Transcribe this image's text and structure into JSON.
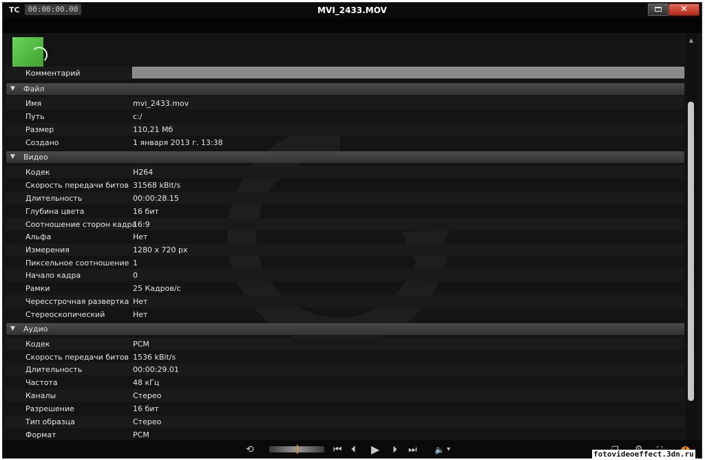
{
  "titlebar": {
    "tc_label": "TC",
    "timecode": "00:00:00.00",
    "title": "MVI_2433.MOV",
    "maximize_icon": "maximize-icon",
    "close_icon": "close-icon",
    "close_symbol": "✕"
  },
  "comment": {
    "label": "Комментарий",
    "value": ""
  },
  "sections": {
    "file": {
      "title": "Файл",
      "rows": [
        {
          "label": "Имя",
          "value": "mvi_2433.mov"
        },
        {
          "label": "Путь",
          "value": "c:/"
        },
        {
          "label": "Размер",
          "value": "110,21 Мб"
        },
        {
          "label": "Создано",
          "value": "1 января 2013 г. 13:38"
        }
      ]
    },
    "video": {
      "title": "Видео",
      "rows": [
        {
          "label": "Кодек",
          "value": "H264"
        },
        {
          "label": "Скорость передачи битов",
          "value": "31568 kBit/s"
        },
        {
          "label": "Длительность",
          "value": "00:00:28.15"
        },
        {
          "label": "Глубина цвета",
          "value": "16 бит"
        },
        {
          "label": "Соотношение сторон кадра",
          "value": "16:9"
        },
        {
          "label": "Альфа",
          "value": "Нет"
        },
        {
          "label": "Измерения",
          "value": "1280 x 720 px"
        },
        {
          "label": "Пиксельное соотношение",
          "value": "1"
        },
        {
          "label": "Начало кадра",
          "value": "0"
        },
        {
          "label": "Рамки",
          "value": "25 Кадров/с"
        },
        {
          "label": "Чересстрочная развертка",
          "value": "Нет"
        },
        {
          "label": "Стереоскопический",
          "value": "Нет"
        }
      ]
    },
    "audio": {
      "title": "Аудио",
      "rows": [
        {
          "label": "Кодек",
          "value": "PCM"
        },
        {
          "label": "Скорость передачи битов",
          "value": "1536 kBit/s"
        },
        {
          "label": "Длительность",
          "value": "00:00:29.01"
        },
        {
          "label": "Частота",
          "value": "48 кГц"
        },
        {
          "label": "Каналы",
          "value": "Стерео"
        },
        {
          "label": "Разрешение",
          "value": "16 бит"
        },
        {
          "label": "Тип образца",
          "value": "Стерео"
        },
        {
          "label": "Формат",
          "value": "PCM"
        }
      ]
    }
  },
  "transport": {
    "loop": "⟲",
    "go_start": "⏮",
    "step_back": "⏴",
    "play": "▶",
    "step_forward": "⏵",
    "go_end": "⏭",
    "volume": "🔈",
    "volume_arrow": "▾",
    "orange_badge": "!"
  },
  "watermark_text": "fotovideoeffect.3dn.ru",
  "colors": {
    "section_header": "#3d3d3d",
    "close_button": "#c8392b",
    "thumbnail": "#55c045",
    "accent": "#f08a10"
  }
}
